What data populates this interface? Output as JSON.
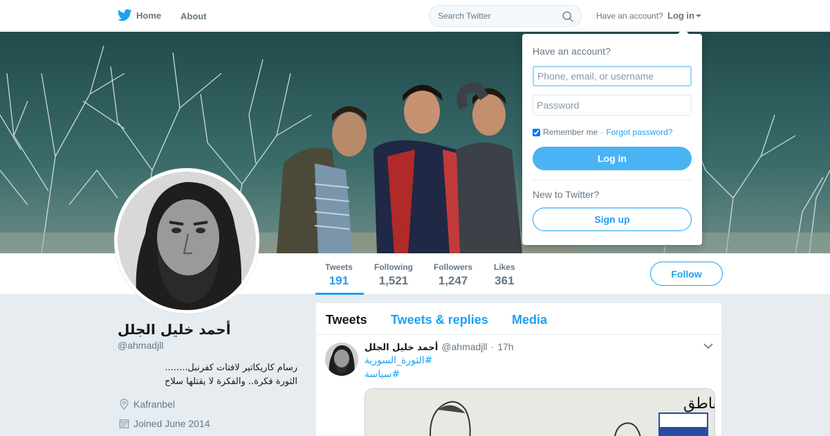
{
  "colors": {
    "accent": "#1da1f2",
    "login_button": "#4ab3f4",
    "page_bg": "#e6ecf0",
    "muted": "#657786"
  },
  "topbar": {
    "home_label": "Home",
    "about_label": "About",
    "search_placeholder": "Search Twitter",
    "have_account": "Have an account?",
    "login_label": "Log in"
  },
  "login_dropdown": {
    "title": "Have an account?",
    "username_placeholder": "Phone, email, or username",
    "password_placeholder": "Password",
    "remember_label": "Remember me",
    "separator": "·",
    "forgot_label": "Forgot password?",
    "login_button": "Log in",
    "new_label": "New to Twitter?",
    "signup_button": "Sign up"
  },
  "profile": {
    "name": "أحمد خليل الجلل",
    "handle": "@ahmadjll",
    "bio_line1": "رسام كاريكاتير لافتات كفرنبل........",
    "bio_line2": "الثورة فكرة.. والفكرة لا يقتلها سلاح",
    "location": "Kafranbel",
    "joined": "Joined June 2014",
    "location_icon": "location-pin-icon",
    "joined_icon": "calendar-icon"
  },
  "stats": [
    {
      "label": "Tweets",
      "value": "191",
      "active": true
    },
    {
      "label": "Following",
      "value": "1,521"
    },
    {
      "label": "Followers",
      "value": "1,247"
    },
    {
      "label": "Likes",
      "value": "361"
    }
  ],
  "follow_label": "Follow",
  "timeline": {
    "tabs": [
      "Tweets",
      "Tweets & replies",
      "Media"
    ],
    "active_tab": 0,
    "tweet": {
      "name": "أحمد خليل الجلل",
      "handle": "@ahmadjll",
      "dot": "·",
      "time": "17h",
      "hashtags": [
        "#الثورة_السورية",
        "#سياسة"
      ],
      "media_caption": "سياسة قضم المناطق"
    }
  }
}
